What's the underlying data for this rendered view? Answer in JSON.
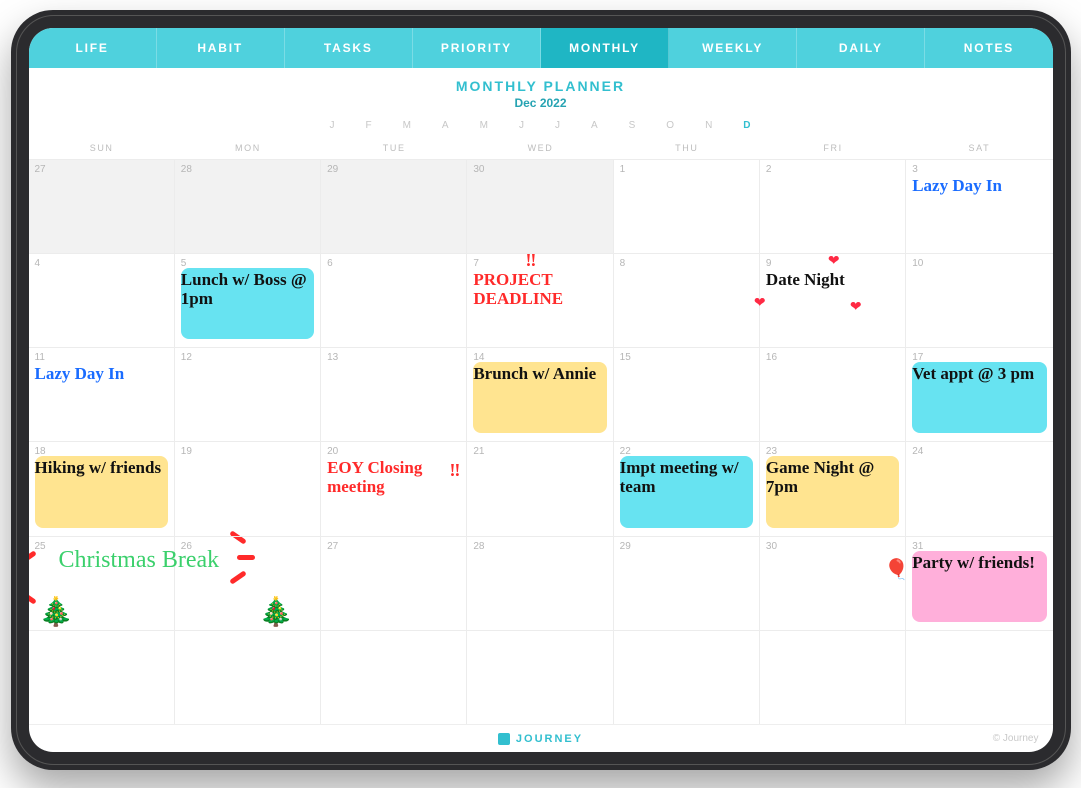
{
  "tabs": [
    "LIFE",
    "HABIT",
    "TASKS",
    "PRIORITY",
    "MONTHLY",
    "WEEKLY",
    "DAILY",
    "NOTES"
  ],
  "active_tab_index": 4,
  "header": {
    "title": "MONTHLY PLANNER",
    "month": "Dec 2022"
  },
  "month_letters": [
    "J",
    "F",
    "M",
    "A",
    "M",
    "J",
    "J",
    "A",
    "S",
    "O",
    "N",
    "D"
  ],
  "active_month_index": 11,
  "weekdays": [
    "SUN",
    "MON",
    "TUE",
    "WED",
    "THU",
    "FRI",
    "SAT"
  ],
  "footer": {
    "brand": "JOURNEY",
    "copyright": "© Journey"
  },
  "cells": [
    {
      "day": "27",
      "prev": true
    },
    {
      "day": "28",
      "prev": true
    },
    {
      "day": "29",
      "prev": true
    },
    {
      "day": "30",
      "prev": true
    },
    {
      "day": "1"
    },
    {
      "day": "2"
    },
    {
      "day": "3",
      "note": "Lazy Day In",
      "color": "blue"
    },
    {
      "day": "4"
    },
    {
      "day": "5",
      "note": "Lunch w/ Boss @ 1pm",
      "hl": "cyan"
    },
    {
      "day": "6"
    },
    {
      "day": "7",
      "note": "PROJECT DEADLINE",
      "color": "red",
      "excl": true
    },
    {
      "day": "8"
    },
    {
      "day": "9",
      "note": "Date Night",
      "hearts": true
    },
    {
      "day": "10"
    },
    {
      "day": "11",
      "note": "Lazy Day In",
      "color": "blue"
    },
    {
      "day": "12"
    },
    {
      "day": "13"
    },
    {
      "day": "14",
      "note": "Brunch w/ Annie",
      "hl": "yellow"
    },
    {
      "day": "15"
    },
    {
      "day": "16"
    },
    {
      "day": "17",
      "note": "Vet appt @ 3 pm",
      "hl": "cyan"
    },
    {
      "day": "18",
      "note": "Hiking w/ friends",
      "hl": "yellow"
    },
    {
      "day": "19"
    },
    {
      "day": "20",
      "note": "EOY Closing meeting",
      "color": "red",
      "excl_side": true
    },
    {
      "day": "21"
    },
    {
      "day": "22",
      "note": "Impt meeting w/ team",
      "hl": "cyan"
    },
    {
      "day": "23",
      "note": "Game Night @ 7pm",
      "hl": "yellow"
    },
    {
      "day": "24"
    },
    {
      "day": "25",
      "christmas": true
    },
    {
      "day": "26"
    },
    {
      "day": "27"
    },
    {
      "day": "28"
    },
    {
      "day": "29"
    },
    {
      "day": "30"
    },
    {
      "day": "31",
      "note": "Party w/ friends!",
      "hl": "pink",
      "balloon": true
    },
    {
      "day": ""
    },
    {
      "day": ""
    },
    {
      "day": ""
    },
    {
      "day": ""
    },
    {
      "day": ""
    },
    {
      "day": ""
    },
    {
      "day": ""
    }
  ],
  "christmas_label": "Christmas Break"
}
